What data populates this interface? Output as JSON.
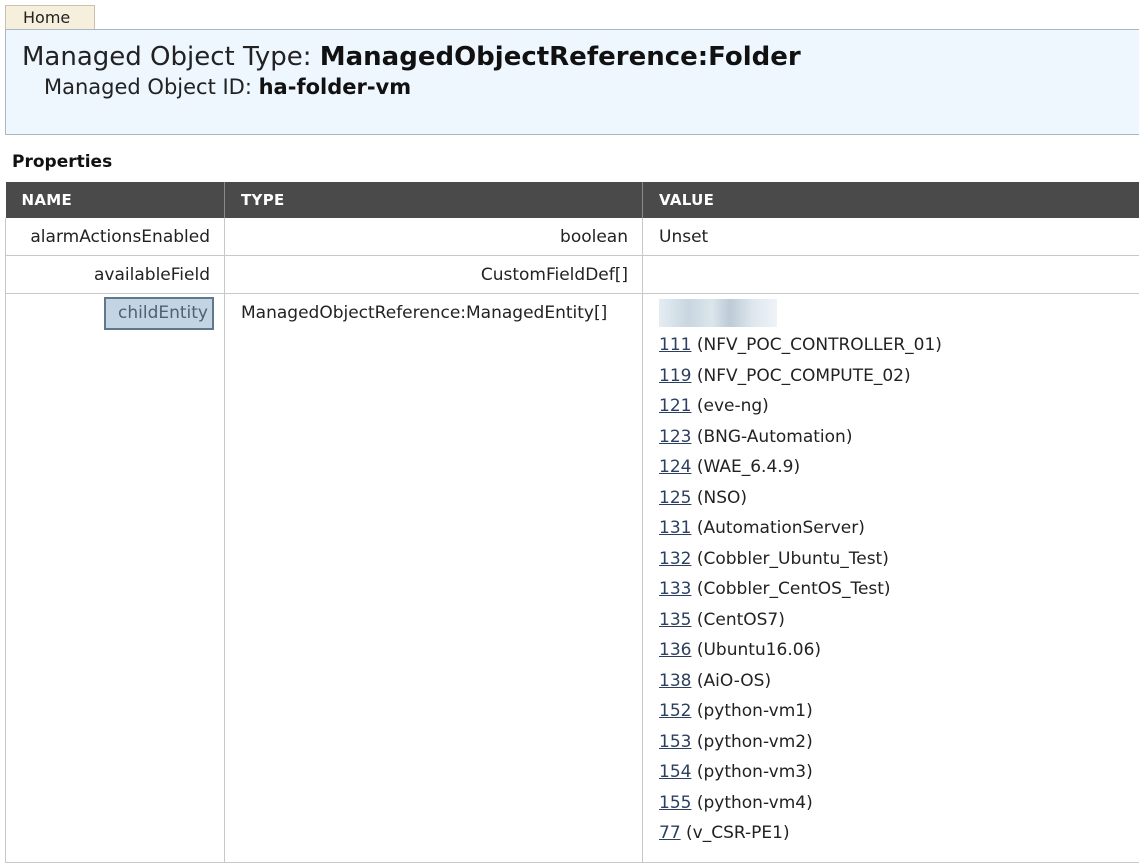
{
  "nav": {
    "home_tab": "Home"
  },
  "header": {
    "type_label": "Managed Object Type: ",
    "type_value": "ManagedObjectReference:Folder",
    "id_label": "Managed Object ID: ",
    "id_value": "ha-folder-vm"
  },
  "properties": {
    "title": "Properties",
    "columns": [
      "NAME",
      "TYPE",
      "VALUE"
    ],
    "rows": [
      {
        "name": "alarmActionsEnabled",
        "type": "boolean",
        "value": "Unset"
      },
      {
        "name": "availableField",
        "type": "CustomFieldDef[]",
        "value": ""
      },
      {
        "name": "childEntity",
        "type": "ManagedObjectReference:ManagedEntity[]",
        "value": ""
      }
    ],
    "child_entities": [
      {
        "id": "111",
        "label": "(NFV_POC_CONTROLLER_01)"
      },
      {
        "id": "119",
        "label": "(NFV_POC_COMPUTE_02)"
      },
      {
        "id": "121",
        "label": "(eve-ng)"
      },
      {
        "id": "123",
        "label": "(BNG-Automation)"
      },
      {
        "id": "124",
        "label": "(WAE_6.4.9)"
      },
      {
        "id": "125",
        "label": "(NSO)"
      },
      {
        "id": "131",
        "label": "(AutomationServer)"
      },
      {
        "id": "132",
        "label": "(Cobbler_Ubuntu_Test)"
      },
      {
        "id": "133",
        "label": "(Cobbler_CentOS_Test)"
      },
      {
        "id": "135",
        "label": "(CentOS7)"
      },
      {
        "id": "136",
        "label": "(Ubuntu16.06)"
      },
      {
        "id": "138",
        "label": "(AiO-OS)"
      },
      {
        "id": "152",
        "label": "(python-vm1)"
      },
      {
        "id": "153",
        "label": "(python-vm2)"
      },
      {
        "id": "154",
        "label": "(python-vm3)"
      },
      {
        "id": "155",
        "label": "(python-vm4)"
      },
      {
        "id": "77",
        "label": "(v_CSR-PE1)"
      }
    ]
  }
}
